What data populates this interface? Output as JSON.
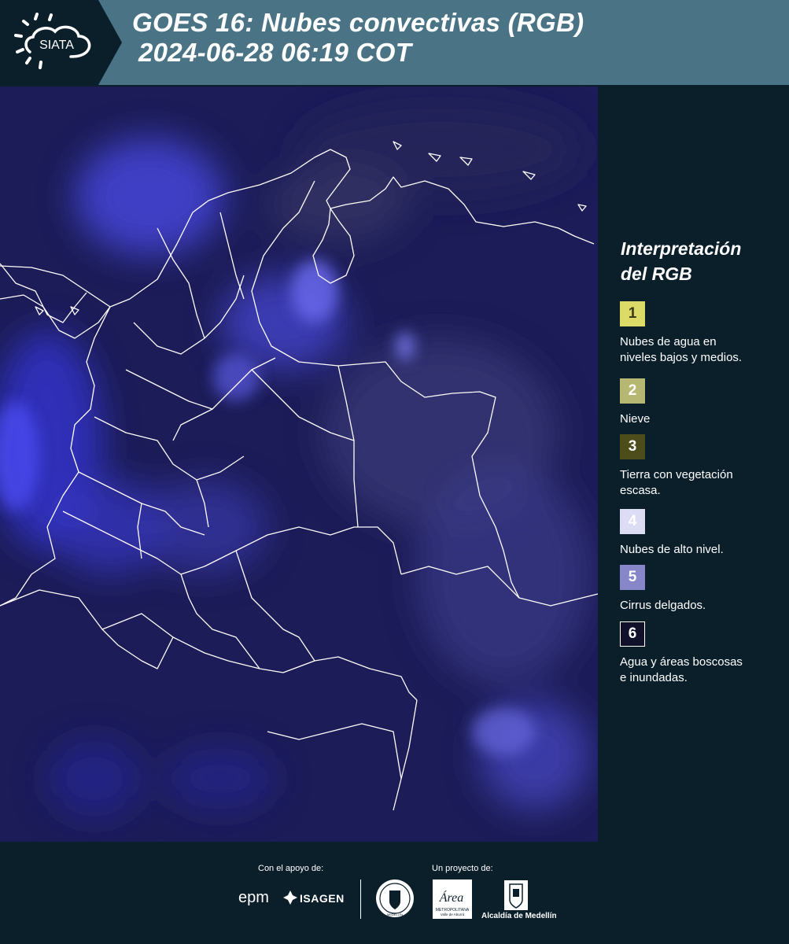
{
  "header": {
    "logo_text": "SIATA",
    "title_line1": "GOES 16: Nubes convectivas (RGB)",
    "title_line2": "2024-06-28 06:19 COT",
    "bg_color": "#4a7485"
  },
  "map": {
    "image_icon": "satellite-imagery",
    "bg_color": "#1e1e5e"
  },
  "legend": {
    "title_line1": "Interpretación",
    "title_line2": "del RGB",
    "items": [
      {
        "num": "1",
        "label_l1": "Nubes de agua en",
        "label_l2": "niveles bajos y medios.",
        "color": "#dddb67",
        "text_color": "#3a3a1a"
      },
      {
        "num": "2",
        "label_l1": "Nieve",
        "label_l2": "",
        "color": "#b7b774",
        "text_color": "#ffffff"
      },
      {
        "num": "3",
        "label_l1": "Tierra con vegetación",
        "label_l2": "escasa.",
        "color": "#4d4d1c",
        "text_color": "#ffffff"
      },
      {
        "num": "4",
        "label_l1": "Nubes de alto nivel.",
        "label_l2": "",
        "color": "#dcdcf4",
        "text_color": "#ffffff"
      },
      {
        "num": "5",
        "label_l1": "Cirrus delgados.",
        "label_l2": "",
        "color": "#8686c8",
        "text_color": "#ffffff"
      },
      {
        "num": "6",
        "label_l1": "Agua y áreas boscosas",
        "label_l2": "e inundadas.",
        "color": "#10102a",
        "text_color": "#ffffff"
      }
    ]
  },
  "footer": {
    "support_label": "Con el apoyo de:",
    "project_label": "Un proyecto de:",
    "sponsor1": "epm",
    "sponsor2": "ISAGEN",
    "area_logo_text": "Área",
    "area_sub1": "METROPOLITANA",
    "area_sub2": "Valle de Aburrá",
    "alcaldia": "Alcaldía de Medellín",
    "seal_text": "MEDELLÍN"
  }
}
